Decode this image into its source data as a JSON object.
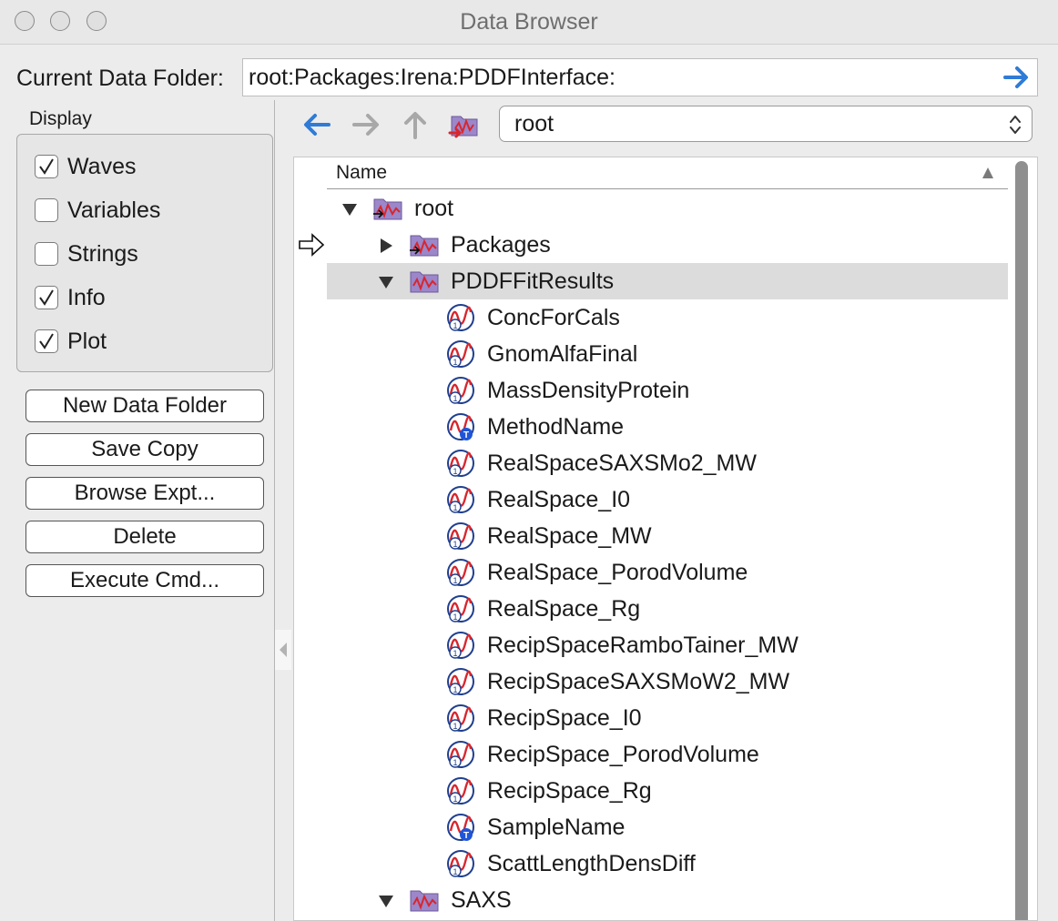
{
  "window": {
    "title": "Data Browser"
  },
  "current_folder": {
    "label": "Current Data Folder:",
    "value": "root:Packages:Irena:PDDFInterface:"
  },
  "display": {
    "label": "Display",
    "options": [
      {
        "label": "Waves",
        "checked": true
      },
      {
        "label": "Variables",
        "checked": false
      },
      {
        "label": "Strings",
        "checked": false
      },
      {
        "label": "Info",
        "checked": true
      },
      {
        "label": "Plot",
        "checked": true
      }
    ]
  },
  "buttons": {
    "new_folder": "New Data Folder",
    "save_copy": "Save Copy",
    "browse_expt": "Browse Expt...",
    "delete": "Delete",
    "execute_cmd": "Execute Cmd..."
  },
  "nav": {
    "folder_select": "root"
  },
  "tree": {
    "header": "Name",
    "rows": [
      {
        "label": "root",
        "kind": "folder",
        "expanded": true
      },
      {
        "label": "Packages",
        "kind": "folder",
        "expanded": false
      },
      {
        "label": "PDDFFitResults",
        "kind": "folder",
        "expanded": true,
        "selected": true
      },
      {
        "label": "ConcForCals",
        "kind": "wave"
      },
      {
        "label": "GnomAlfaFinal",
        "kind": "wave"
      },
      {
        "label": "MassDensityProtein",
        "kind": "wave"
      },
      {
        "label": "MethodName",
        "kind": "text-wave"
      },
      {
        "label": "RealSpaceSAXSMo2_MW",
        "kind": "wave"
      },
      {
        "label": "RealSpace_I0",
        "kind": "wave"
      },
      {
        "label": "RealSpace_MW",
        "kind": "wave"
      },
      {
        "label": "RealSpace_PorodVolume",
        "kind": "wave"
      },
      {
        "label": "RealSpace_Rg",
        "kind": "wave"
      },
      {
        "label": "RecipSpaceRamboTainer_MW",
        "kind": "wave"
      },
      {
        "label": "RecipSpaceSAXSMoW2_MW",
        "kind": "wave"
      },
      {
        "label": "RecipSpace_I0",
        "kind": "wave"
      },
      {
        "label": "RecipSpace_PorodVolume",
        "kind": "wave"
      },
      {
        "label": "RecipSpace_Rg",
        "kind": "wave"
      },
      {
        "label": "SampleName",
        "kind": "text-wave"
      },
      {
        "label": "ScattLengthDensDiff",
        "kind": "wave"
      },
      {
        "label": "SAXS",
        "kind": "folder",
        "expanded": true
      }
    ]
  },
  "colors": {
    "nav_blue": "#2f7bd6",
    "wave_red": "#d8262e",
    "folder_purple": "#9b87c9"
  }
}
